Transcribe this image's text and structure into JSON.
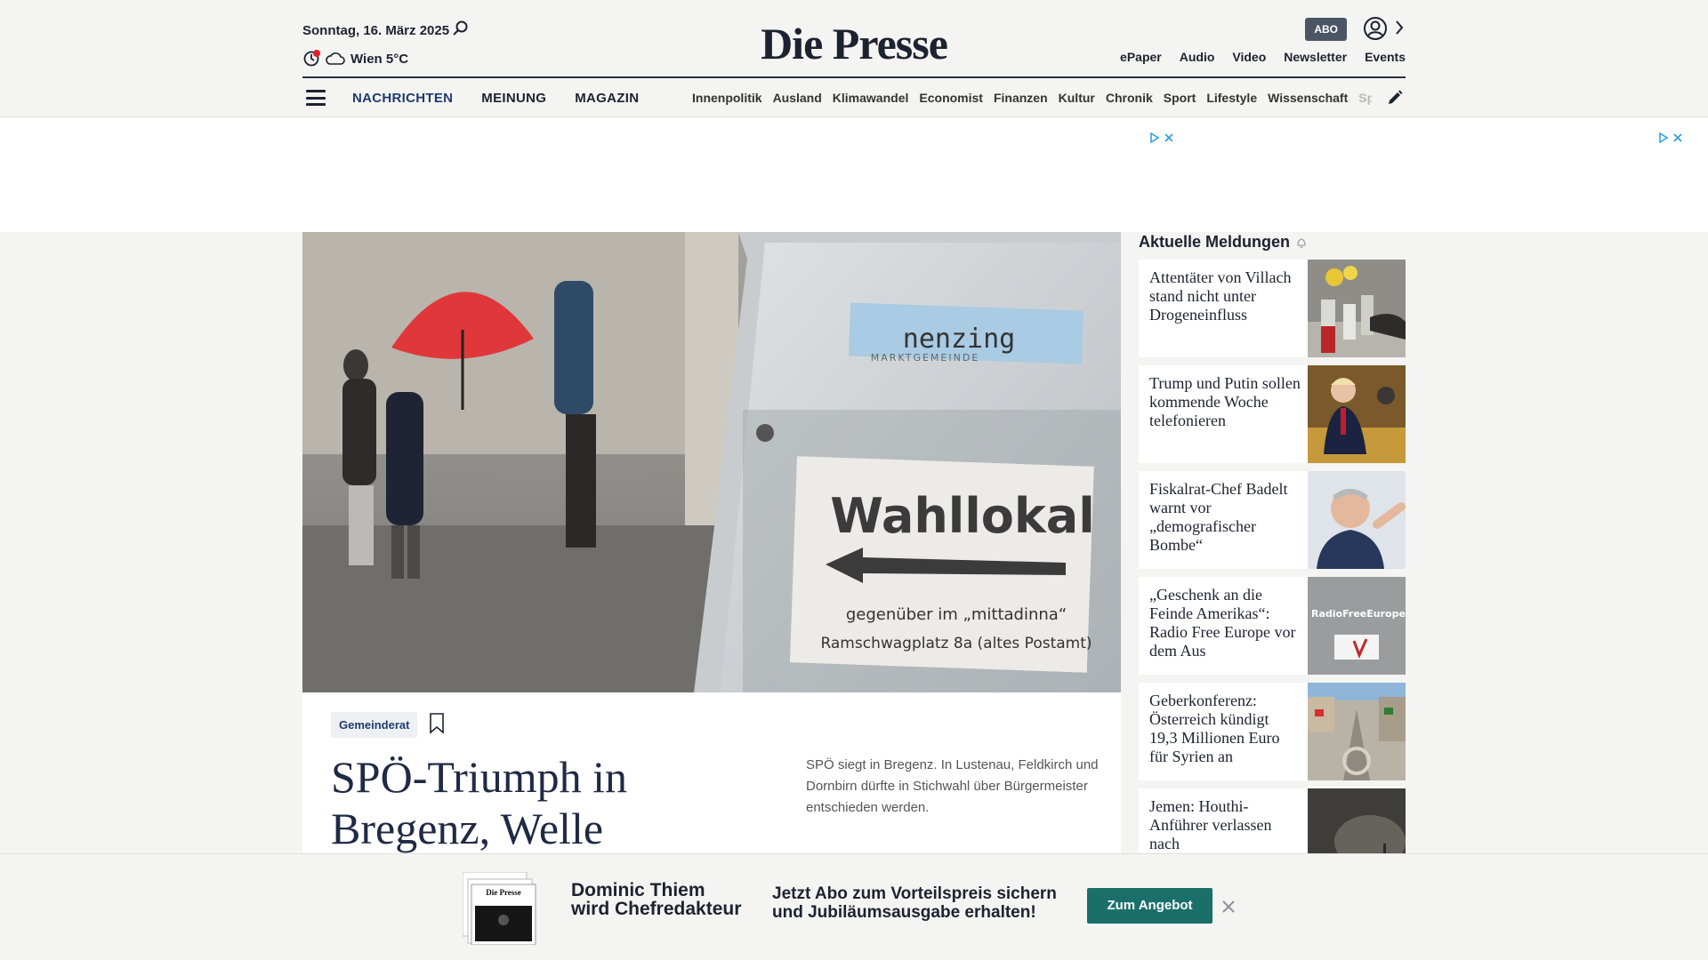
{
  "header": {
    "date": "Sonntag, 16. März 2025",
    "weather": "Wien 5°C",
    "logo": "Die Presse",
    "abo_label": "ABO",
    "top_links": [
      "ePaper",
      "Audio",
      "Video",
      "Newsletter",
      "Events"
    ]
  },
  "nav": {
    "main": [
      "NACHRICHTEN",
      "MEINUNG",
      "MAGAZIN"
    ],
    "sub": [
      "Innenpolitik",
      "Ausland",
      "Klimawandel",
      "Economist",
      "Finanzen",
      "Kultur",
      "Chronik",
      "Sport",
      "Lifestyle",
      "Wissenschaft",
      "Spectrum"
    ]
  },
  "hero": {
    "sign_top": "nenzing",
    "sign_small": "MARKTGEMEINDE",
    "sign_main": "Wahllokal",
    "sign_line1": "gegenüber im „mittadinna“",
    "sign_line2": "Ramschwagplatz 8a (altes Postamt)"
  },
  "article": {
    "tag": "Gemeinderat",
    "headline": "SPÖ-Triumph in Bregenz, Welle",
    "teaser": "SPÖ siegt in Bregenz. In Lustenau, Feldkirch und Dornbirn dürfte in Stichwahl über Bürgermeister entschieden werden."
  },
  "sidebar": {
    "title": "Aktuelle Meldungen",
    "items": [
      {
        "title": "Attentäter von Villach stand nicht unter Drogeneinfluss"
      },
      {
        "title": "Trump und Putin sollen kommende Woche telefonieren"
      },
      {
        "title": "Fiskalrat-Chef Badelt warnt vor „demografischer Bombe“"
      },
      {
        "title": "„Geschenk an die Feinde Amerikas“: Radio Free Europe vor dem Aus"
      },
      {
        "title": "Geberkonferenz: Österreich kündigt 19,3 Millionen Euro für Syrien an"
      },
      {
        "title": "Jemen: Houthi-Anführer verlassen nach"
      }
    ],
    "thumb_text": "RadioFreeEurope RadioLiberty"
  },
  "promo": {
    "name_line1": "Dominic Thiem",
    "name_line2": "wird Chefredakteur",
    "text_line1": "Jetzt Abo zum Vorteilspreis sichern",
    "text_line2": "und Jubiläumsausgabe erhalten!",
    "button": "Zum Angebot",
    "paper_logo": "Die Presse"
  }
}
